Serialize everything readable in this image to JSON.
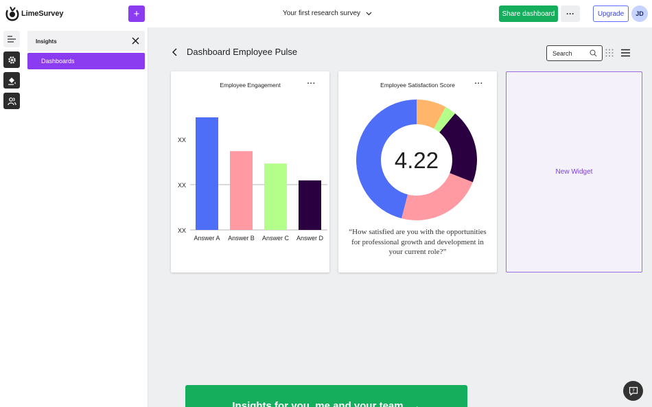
{
  "app": {
    "name": "LimeSurvey"
  },
  "topbar": {
    "survey_title": "Your first research survey",
    "share_label": "Share dashboard",
    "more_label": "···",
    "upgrade_label": "Upgrade",
    "avatar_initials": "JD",
    "add_label": "+"
  },
  "side_panel": {
    "title": "Insights",
    "items": [
      {
        "label": "Dashboards",
        "active": true
      }
    ]
  },
  "main": {
    "page_title": "Dashboard Employee Pulse",
    "search_label": "Search"
  },
  "widgets": [
    {
      "title": "Employee Engagement",
      "menu": "···"
    },
    {
      "title": "Employee Satisfaction Score",
      "menu": "···",
      "score": "4.22",
      "question": "“How satisfied are you with the opportunities for professional growth and development in your current role?”"
    },
    {
      "label": "New Widget"
    }
  ],
  "chart_data": [
    {
      "type": "bar",
      "title": "Employee Engagement",
      "categories": [
        "Answer A",
        "Answer B",
        "Answer C",
        "Answer D"
      ],
      "values": [
        100,
        70,
        59,
        44
      ],
      "ylim": [
        0,
        100
      ],
      "yticks": [
        "XX",
        "XX",
        "XX"
      ],
      "colors": [
        "#4f6ef7",
        "#ff9aa2",
        "#b3ff8a",
        "#2a0040"
      ],
      "grid": false
    },
    {
      "type": "pie",
      "title": "Employee Satisfaction Score",
      "center_label": "4.22",
      "values": [
        46,
        23,
        20,
        3,
        8
      ],
      "colors": [
        "#4f6ef7",
        "#ff9aa2",
        "#2a0040",
        "#b3ff8a",
        "#ffb66b"
      ]
    }
  ],
  "banner": {
    "text": "Insights for you, me and your team",
    "arrow": "→"
  },
  "colors": {
    "accent": "#8b3cf0",
    "primary_green": "#14ae5c",
    "upgrade_blue": "#3c46d6"
  }
}
